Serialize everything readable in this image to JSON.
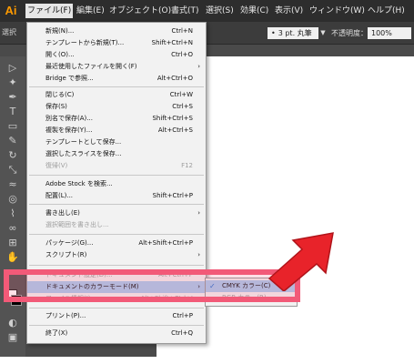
{
  "colors": {
    "accent": "#ff9a00",
    "highlight": "#a9ccf0",
    "callout": "#f25a78",
    "arrow": "#e8232a"
  },
  "app": {
    "logo": "Ai"
  },
  "menubar": {
    "items": [
      {
        "label": "ファイル(F)"
      },
      {
        "label": "編集(E)"
      },
      {
        "label": "オブジェクト(O)"
      },
      {
        "label": "書式(T)"
      },
      {
        "label": "選択(S)"
      },
      {
        "label": "効果(C)"
      },
      {
        "label": "表示(V)"
      },
      {
        "label": "ウィンドウ(W)"
      },
      {
        "label": "ヘルプ(H)"
      }
    ]
  },
  "controlbar": {
    "left_text": "選択",
    "stroke_value": "3 pt. 丸筆",
    "opacity_label": "不透明度：",
    "opacity_value": "100%"
  },
  "file_menu": {
    "items": [
      {
        "label": "新規(N)...",
        "shortcut": "Ctrl+N"
      },
      {
        "label": "テンプレートから新規(T)...",
        "shortcut": "Shift+Ctrl+N"
      },
      {
        "label": "開く(O)...",
        "shortcut": "Ctrl+O"
      },
      {
        "label": "最近使用したファイルを開く(F)",
        "shortcut": "",
        "arrow": "›"
      },
      {
        "label": "Bridge で参照...",
        "shortcut": "Alt+Ctrl+O"
      },
      {
        "label": "閉じる(C)",
        "shortcut": "Ctrl+W"
      },
      {
        "label": "保存(S)",
        "shortcut": "Ctrl+S"
      },
      {
        "label": "別名で保存(A)...",
        "shortcut": "Shift+Ctrl+S"
      },
      {
        "label": "複製を保存(Y)...",
        "shortcut": "Alt+Ctrl+S"
      },
      {
        "label": "テンプレートとして保存...",
        "shortcut": ""
      },
      {
        "label": "選択したスライスを保存...",
        "shortcut": ""
      },
      {
        "label": "復帰(V)",
        "shortcut": "F12"
      },
      {
        "label": "Adobe Stock を検索...",
        "shortcut": ""
      },
      {
        "label": "配置(L)...",
        "shortcut": "Shift+Ctrl+P"
      },
      {
        "label": "書き出し(E)",
        "shortcut": "",
        "arrow": "›"
      },
      {
        "label": "選択範囲を書き出し...",
        "shortcut": ""
      },
      {
        "label": "パッケージ(G)...",
        "shortcut": "Alt+Shift+Ctrl+P"
      },
      {
        "label": "スクリプト(R)",
        "shortcut": "",
        "arrow": "›"
      },
      {
        "label": "ドキュメント設定(D)...",
        "shortcut": "Alt+Ctrl+P"
      },
      {
        "label": "ドキュメントのカラーモード(M)",
        "shortcut": "",
        "arrow": "›"
      },
      {
        "label": "ファイル情報(I)...",
        "shortcut": "Alt+Shift+Ctrl+I"
      },
      {
        "label": "プリント(P)...",
        "shortcut": "Ctrl+P"
      },
      {
        "label": "終了(X)",
        "shortcut": "Ctrl+Q"
      }
    ]
  },
  "color_mode_submenu": {
    "items": [
      {
        "label": "CMYK カラー(C)",
        "check": "✓"
      },
      {
        "label": "RGB カラー(R)",
        "check": ""
      }
    ]
  }
}
